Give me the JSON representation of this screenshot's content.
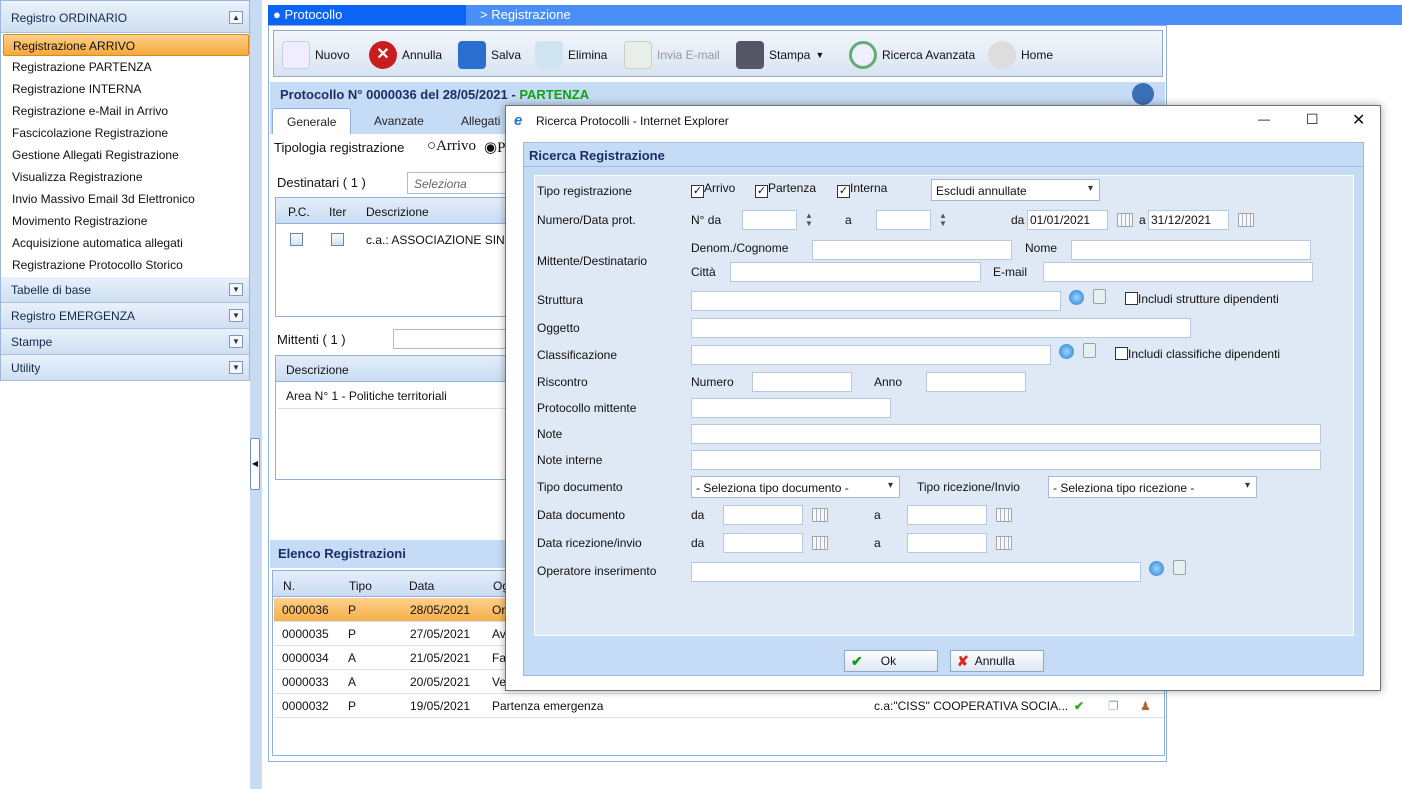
{
  "sidebar": {
    "header": "Registro ORDINARIO",
    "items": [
      "Registrazione ARRIVO",
      "Registrazione PARTENZA",
      "Registrazione INTERNA",
      "Registrazione e-Mail in Arrivo",
      "Fascicolazione Registrazione",
      "Gestione Allegati Registrazione",
      "Visualizza Registrazione",
      "Invio Massivo Email 3d Elettronico",
      "Movimento Registrazione",
      "Acquisizione automatica allegati",
      "Registrazione Protocollo Storico"
    ],
    "sections": [
      "Tabelle di base",
      "Registro EMERGENZA",
      "Stampe",
      "Utility"
    ]
  },
  "breadcrumb": {
    "root": "Protocollo",
    "current": "> Registrazione"
  },
  "toolbar": {
    "nuovo": "Nuovo",
    "annulla": "Annulla",
    "salva": "Salva",
    "elimina": "Elimina",
    "invia": "Invia E-mail",
    "stampa": "Stampa",
    "ricerca": "Ricerca Avanzata",
    "home": "Home"
  },
  "protocol": {
    "title": "Protocollo N° 0000036 del 28/05/2021 - ",
    "type": "PARTENZA"
  },
  "tabs": [
    "Generale",
    "Avanzate",
    "Allegati"
  ],
  "form": {
    "tipologia_label": "Tipologia registrazione",
    "radio_arrivo": "Arrivo",
    "radio_partenza": "P",
    "destinatari_label": "Destinatari ( 1 )",
    "destinatari_placeholder": "Seleziona",
    "dest_cols": [
      "P.C.",
      "Iter",
      "Descrizione"
    ],
    "dest_row": "c.a.: ASSOCIAZIONE SINDA",
    "mittenti_label": "Mittenti ( 1 )",
    "mitt_col": "Descrizione",
    "mitt_row": "Area N° 1 - Politiche territoriali"
  },
  "elenco": {
    "title": "Elenco Registrazioni",
    "columns": [
      "N.",
      "Tipo",
      "Data",
      "Og"
    ],
    "rows": [
      {
        "n": "0000036",
        "tipo": "P",
        "data": "28/05/2021",
        "ogg": "Or"
      },
      {
        "n": "0000035",
        "tipo": "P",
        "data": "27/05/2021",
        "ogg": "Av"
      },
      {
        "n": "0000034",
        "tipo": "A",
        "data": "21/05/2021",
        "ogg": "Fat"
      },
      {
        "n": "0000033",
        "tipo": "A",
        "data": "20/05/2021",
        "ogg": "Ve"
      },
      {
        "n": "0000032",
        "tipo": "P",
        "data": "19/05/2021",
        "ogg": "Partenza emergenza",
        "dest": "c.a:\"CISS\" COOPERATIVA SOCIA..."
      }
    ]
  },
  "dialog": {
    "title": "Ricerca Protocolli - Internet Explorer",
    "header": "Ricerca Registrazione",
    "tipo_reg": "Tipo registrazione",
    "chk_arrivo": "Arrivo",
    "chk_partenza": "Partenza",
    "chk_interna": "Interna",
    "escludi": "Escludi annullate",
    "numero_data": "Numero/Data prot.",
    "n_da": "N° da",
    "a": "a",
    "da": "da",
    "date_from": "01/01/2021",
    "date_to": "31/12/2021",
    "mittente": "Mittente/Destinatario",
    "denom": "Denom./Cognome",
    "nome": "Nome",
    "citta": "Città",
    "email": "E-mail",
    "struttura": "Struttura",
    "includi_strutture": "Includi strutture dipendenti",
    "oggetto": "Oggetto",
    "classificazione": "Classificazione",
    "includi_class": "Includi classifiche dipendenti",
    "riscontro": "Riscontro",
    "numero": "Numero",
    "anno": "Anno",
    "prot_mittente": "Protocollo mittente",
    "note": "Note",
    "note_interne": "Note interne",
    "tipo_doc": "Tipo documento",
    "tipo_doc_sel": "- Seleziona tipo documento -",
    "tipo_ric": "Tipo ricezione/Invio",
    "tipo_ric_sel": "- Seleziona tipo ricezione -",
    "data_doc": "Data documento",
    "data_ric": "Data ricezione/invio",
    "operatore": "Operatore inserimento",
    "ok": "Ok",
    "annulla": "Annulla"
  },
  "colors": {
    "accent": "#0a64f5",
    "selected": "#f6a83b",
    "panel": "#c6dcf6",
    "partenza": "#11a311"
  }
}
